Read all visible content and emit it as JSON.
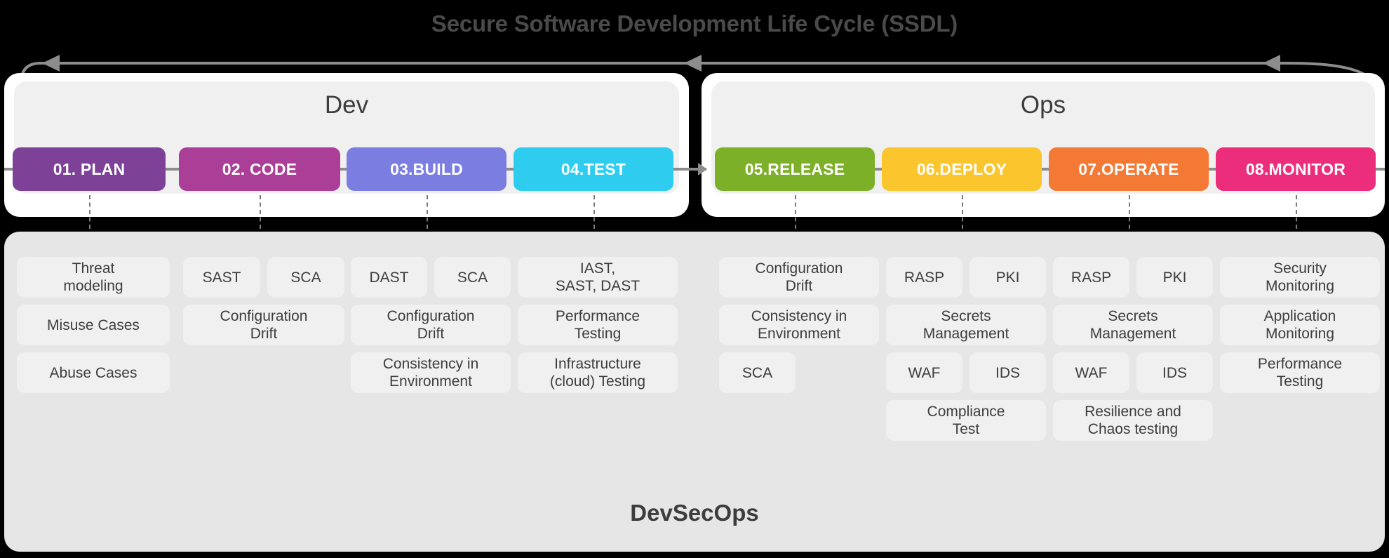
{
  "title": "Secure Software Development Life Cycle (SSDL)",
  "footer_label": "DevSecOps",
  "colors": {
    "plan": "#7d4298",
    "code": "#ab3f97",
    "build": "#7b7ee0",
    "test": "#2ecdf0",
    "release": "#7cb029",
    "deploy": "#fbc52d",
    "operate": "#f37934",
    "monitor": "#ec2d7b",
    "connector": "#8c8c8c",
    "panel_bg": "#ffffff",
    "panel_inner_bg": "#f0f0f0",
    "card_bg": "#e6e6e6",
    "cell_bg": "#f0f0f0",
    "text_dark": "#3d3d3d",
    "page_bg": "#000000"
  },
  "sections": [
    {
      "name": "dev",
      "label": "Dev"
    },
    {
      "name": "ops",
      "label": "Ops"
    }
  ],
  "phases": [
    {
      "id": "plan",
      "label": "01. PLAN",
      "section": "dev",
      "color_key": "plan"
    },
    {
      "id": "code",
      "label": "02. CODE",
      "section": "dev",
      "color_key": "code"
    },
    {
      "id": "build",
      "label": "03.BUILD",
      "section": "dev",
      "color_key": "build"
    },
    {
      "id": "test",
      "label": "04.TEST",
      "section": "dev",
      "color_key": "test"
    },
    {
      "id": "release",
      "label": "05.RELEASE",
      "section": "ops",
      "color_key": "release"
    },
    {
      "id": "deploy",
      "label": "06.DEPLOY",
      "section": "ops",
      "color_key": "deploy"
    },
    {
      "id": "operate",
      "label": "07.OPERATE",
      "section": "ops",
      "color_key": "operate"
    },
    {
      "id": "monitor",
      "label": "08.MONITOR",
      "section": "ops",
      "color_key": "monitor"
    }
  ],
  "columns": [
    {
      "phase_id": "plan",
      "rows": [
        [
          {
            "text": "Threat\nmodeling",
            "span": "full"
          }
        ],
        [
          {
            "text": "Misuse Cases",
            "span": "full"
          }
        ],
        [
          {
            "text": "Abuse Cases",
            "span": "full"
          }
        ]
      ]
    },
    {
      "phase_id": "code",
      "rows": [
        [
          {
            "text": "SAST",
            "span": "half"
          },
          {
            "text": "SCA",
            "span": "half"
          }
        ],
        [
          {
            "text": "Configuration\nDrift",
            "span": "full"
          }
        ]
      ]
    },
    {
      "phase_id": "build",
      "rows": [
        [
          {
            "text": "DAST",
            "span": "half"
          },
          {
            "text": "SCA",
            "span": "half"
          }
        ],
        [
          {
            "text": "Configuration\nDrift",
            "span": "full"
          }
        ],
        [
          {
            "text": "Consistency in\nEnvironment",
            "span": "full"
          }
        ]
      ]
    },
    {
      "phase_id": "test",
      "rows": [
        [
          {
            "text": "IAST,\nSAST, DAST",
            "span": "full"
          }
        ],
        [
          {
            "text": "Performance\nTesting",
            "span": "full"
          }
        ],
        [
          {
            "text": "Infrastructure\n(cloud) Testing",
            "span": "full"
          }
        ]
      ]
    },
    {
      "phase_id": "release",
      "rows": [
        [
          {
            "text": "Configuration\nDrift",
            "span": "full"
          }
        ],
        [
          {
            "text": "Consistency in\nEnvironment",
            "span": "full"
          }
        ],
        [
          {
            "text": "SCA",
            "span": "half"
          },
          {
            "text": "",
            "span": "half",
            "spacer": true
          }
        ]
      ]
    },
    {
      "phase_id": "deploy",
      "rows": [
        [
          {
            "text": "RASP",
            "span": "half"
          },
          {
            "text": "PKI",
            "span": "half"
          }
        ],
        [
          {
            "text": "Secrets\nManagement",
            "span": "full"
          }
        ],
        [
          {
            "text": "WAF",
            "span": "half"
          },
          {
            "text": "IDS",
            "span": "half"
          }
        ],
        [
          {
            "text": "Compliance\nTest",
            "span": "full"
          }
        ]
      ]
    },
    {
      "phase_id": "operate",
      "rows": [
        [
          {
            "text": "RASP",
            "span": "half"
          },
          {
            "text": "PKI",
            "span": "half"
          }
        ],
        [
          {
            "text": "Secrets\nManagement",
            "span": "full"
          }
        ],
        [
          {
            "text": "WAF",
            "span": "half"
          },
          {
            "text": "IDS",
            "span": "half"
          }
        ],
        [
          {
            "text": "Resilience and\nChaos testing",
            "span": "full"
          }
        ]
      ]
    },
    {
      "phase_id": "monitor",
      "rows": [
        [
          {
            "text": "Security\nMonitoring",
            "span": "full"
          }
        ],
        [
          {
            "text": "Application\nMonitoring",
            "span": "full"
          }
        ],
        [
          {
            "text": "Performance\nTesting",
            "span": "full"
          }
        ]
      ]
    }
  ],
  "feedback_loop": {
    "description": "continuous feedback arrow wrapping the lifecycle",
    "arrowheads": 3,
    "direction": "right-to-left"
  }
}
